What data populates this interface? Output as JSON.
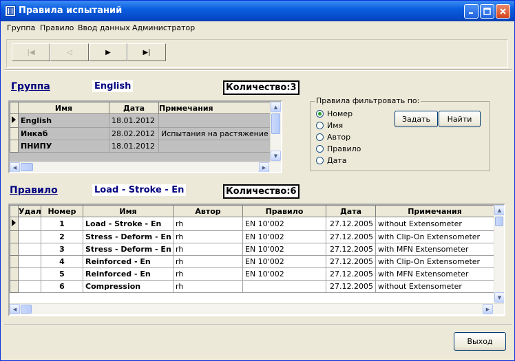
{
  "window": {
    "title": "Правила испытаний"
  },
  "menu": [
    "Группа",
    "Правило",
    "Ввод данных",
    "Администратор"
  ],
  "nav": {
    "first": "first-icon",
    "prev": "prev-icon",
    "next": "next-icon",
    "last": "last-icon"
  },
  "group": {
    "header": "Группа",
    "current": "English",
    "count_label": "Количество:3",
    "columns": [
      "Имя",
      "Дата",
      "Примечания"
    ],
    "rows": [
      {
        "name": "English",
        "date": "18.01.2012",
        "note": ""
      },
      {
        "name": "Инкаб",
        "date": "28.02.2012",
        "note": "Испытания на растяжение"
      },
      {
        "name": "ПНИПУ",
        "date": "18.01.2012",
        "note": ""
      }
    ]
  },
  "filter": {
    "label": "Правила фильтровать по:",
    "options": [
      "Номер",
      "Имя",
      "Автор",
      "Правило",
      "Дата"
    ],
    "selected": "Номер",
    "set_button": "Задать",
    "find_button": "Найти"
  },
  "rule": {
    "header": "Правило",
    "current": "Load - Stroke - En",
    "count_label": "Количество:6",
    "columns": [
      "Удал",
      "Номер",
      "Имя",
      "Автор",
      "Правило",
      "Дата",
      "Примечания"
    ],
    "rows": [
      {
        "del": "",
        "num": "1",
        "name": "Load - Stroke - En",
        "author": "rh",
        "rule": "EN 10'002",
        "date": "27.12.2005",
        "note": "without Extensometer"
      },
      {
        "del": "",
        "num": "2",
        "name": "Stress - Deform - En",
        "author": "rh",
        "rule": "EN 10'002",
        "date": "27.12.2005",
        "note": "with Clip-On Extensometer"
      },
      {
        "del": "",
        "num": "3",
        "name": "Stress - Deform - En",
        "author": "rh",
        "rule": "EN 10'002",
        "date": "27.12.2005",
        "note": "with MFN Extensometer"
      },
      {
        "del": "",
        "num": "4",
        "name": "Reinforced - En",
        "author": "rh",
        "rule": "EN 10'002",
        "date": "27.12.2005",
        "note": "with Clip-On Extensometer"
      },
      {
        "del": "",
        "num": "5",
        "name": "Reinforced - En",
        "author": "rh",
        "rule": "EN 10'002",
        "date": "27.12.2005",
        "note": "with MFN Extensometer"
      },
      {
        "del": "",
        "num": "6",
        "name": "Compression",
        "author": "rh",
        "rule": "",
        "date": "27.12.2005",
        "note": "without Extensometer"
      }
    ]
  },
  "exit_button": "Выход"
}
